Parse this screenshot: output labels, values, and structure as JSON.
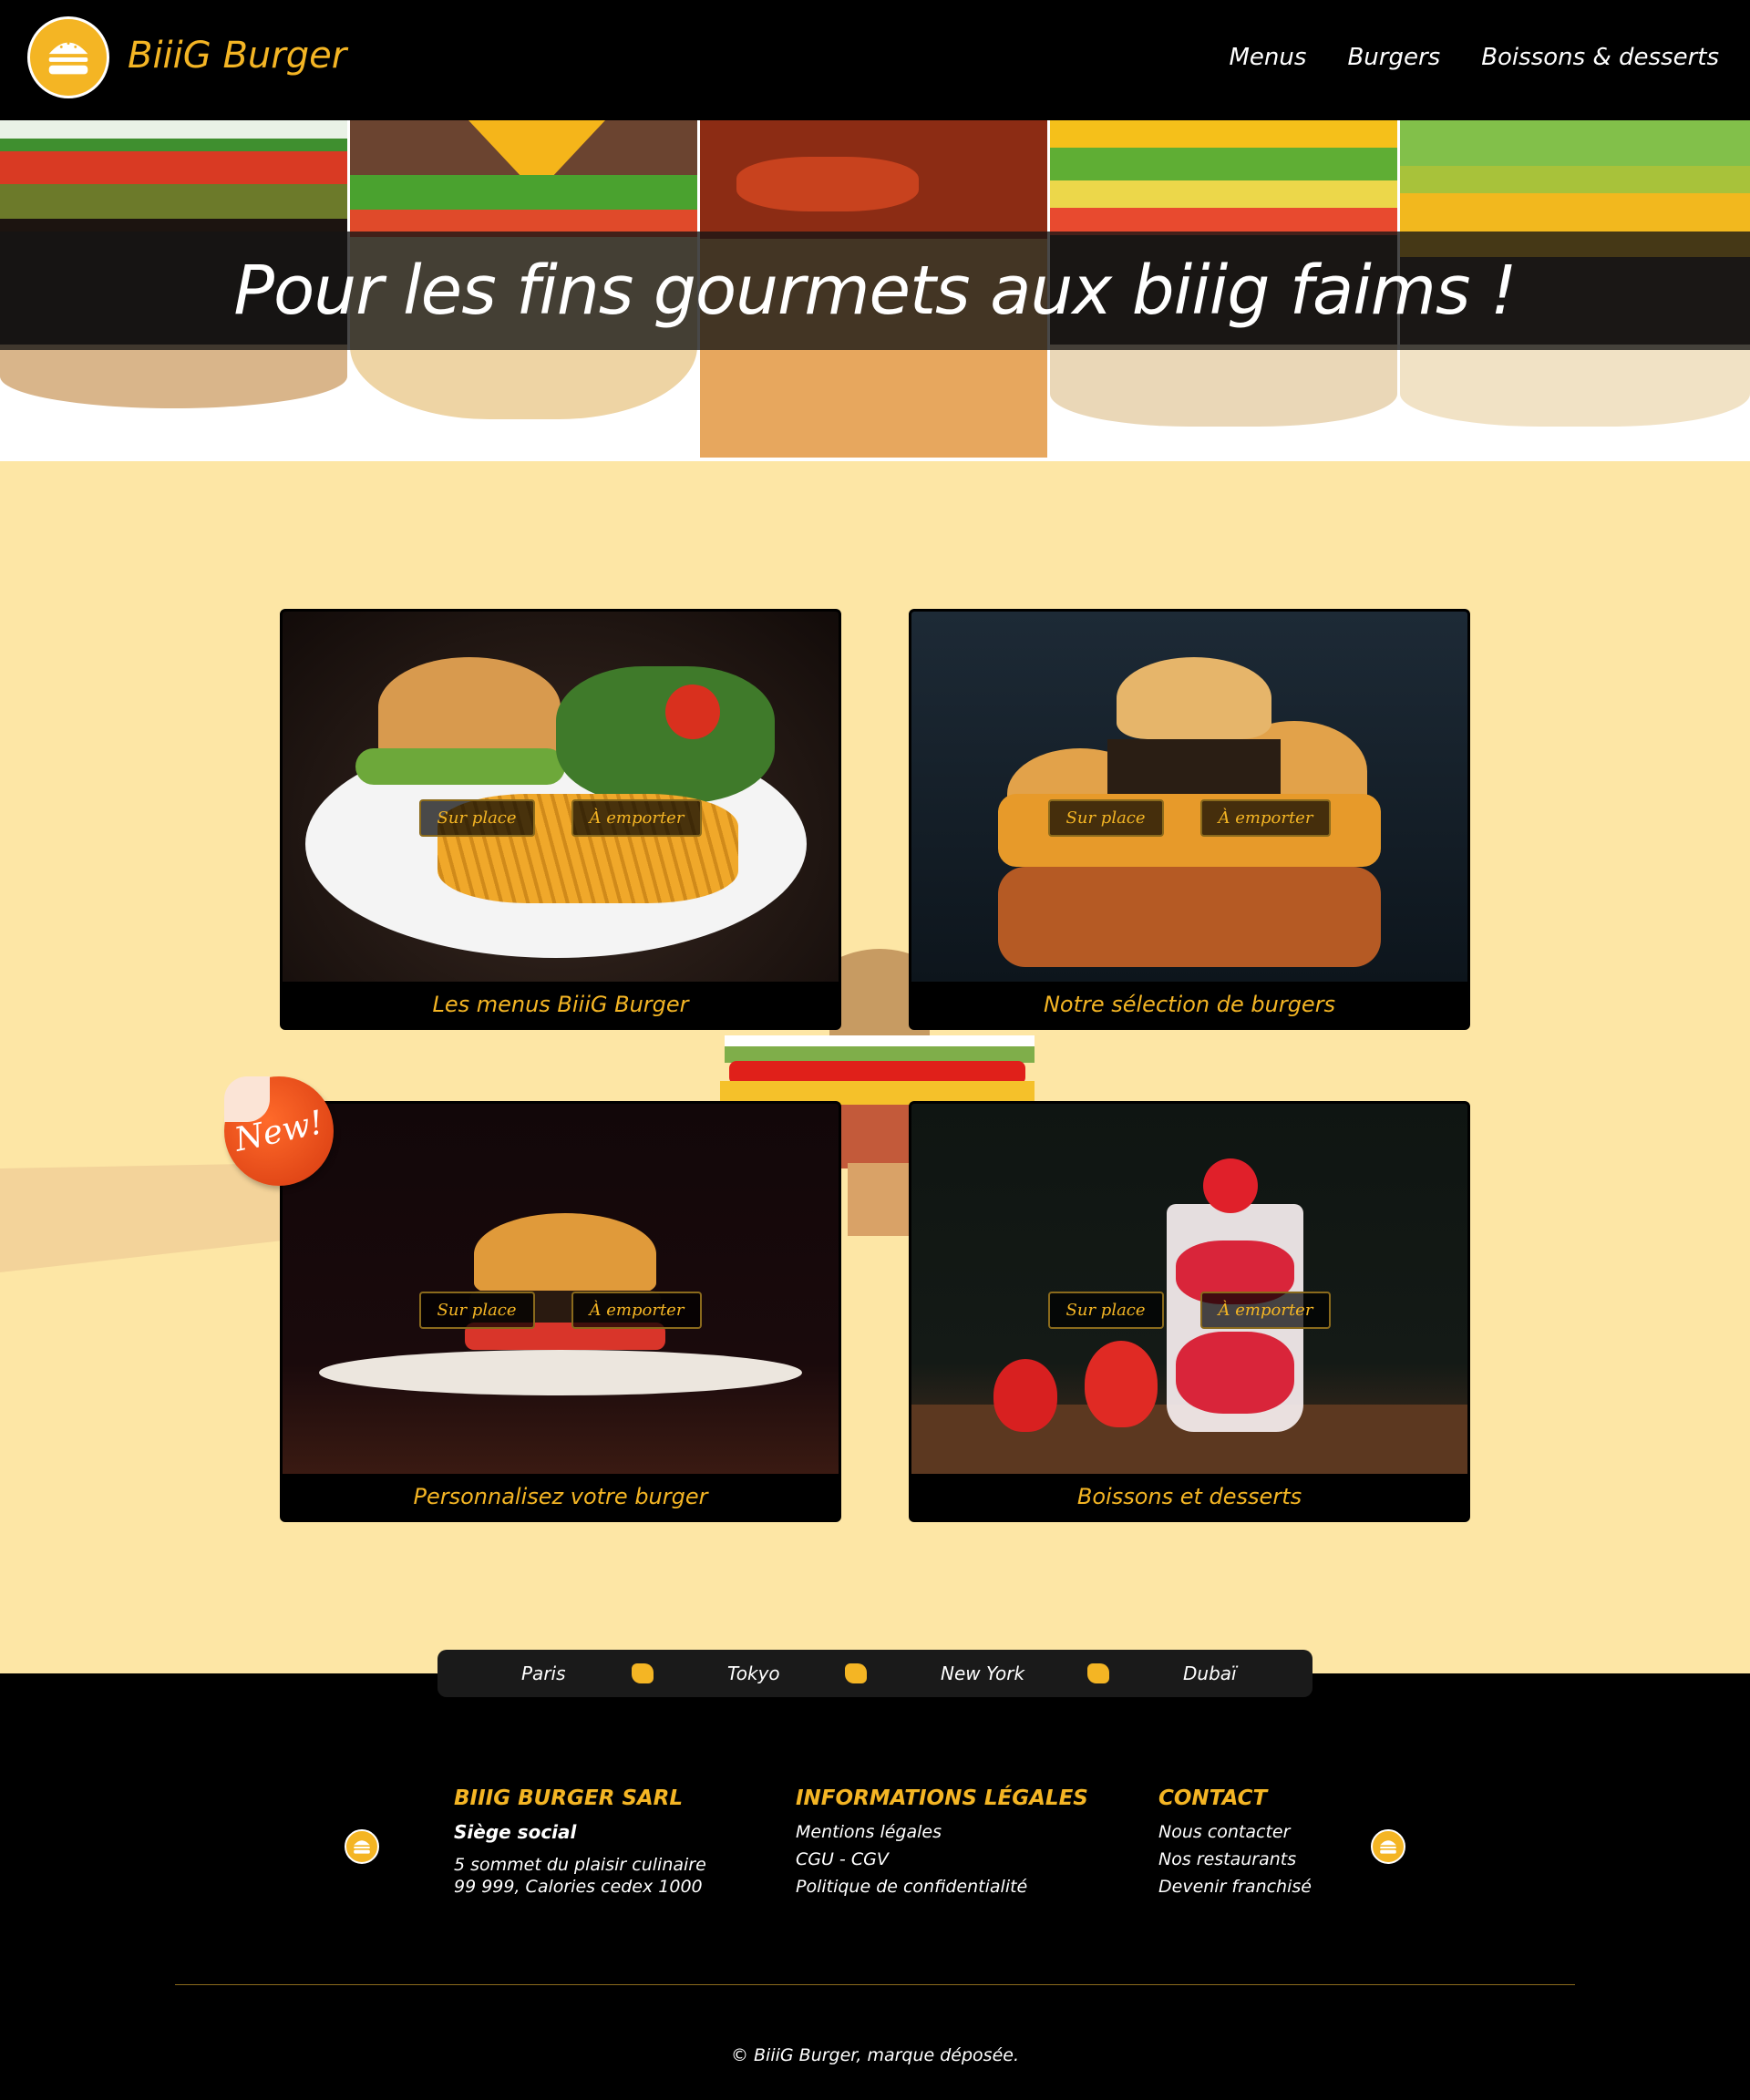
{
  "header": {
    "brand": "BiiiG Burger",
    "nav": [
      "Menus",
      "Burgers",
      "Boissons & desserts"
    ]
  },
  "hero": {
    "tagline": "Pour les fins gourmets aux biiig faims !"
  },
  "cards": [
    {
      "caption": "Les menus BiiiG Burger",
      "btn_place": "Sur place",
      "btn_emporter": "À emporter"
    },
    {
      "caption": "Notre sélection de burgers",
      "btn_place": "Sur place",
      "btn_emporter": "À emporter"
    },
    {
      "caption": "Personnalisez votre burger",
      "btn_place": "Sur place",
      "btn_emporter": "À emporter"
    },
    {
      "caption": "Boissons et desserts",
      "btn_place": "Sur place",
      "btn_emporter": "À emporter"
    }
  ],
  "badge": "New!",
  "cities": [
    "Paris",
    "Tokyo",
    "New York",
    "Dubaï"
  ],
  "footer": {
    "company": {
      "title": "BIIIG BURGER SARL",
      "sub": "Siège social",
      "line1": "5 sommet du plaisir culinaire",
      "line2": "99 999, Calories cedex 1000"
    },
    "legal": {
      "title": "INFORMATIONS LÉGALES",
      "links": [
        "Mentions légales",
        "CGU - CGV",
        "Politique de confidentialité"
      ]
    },
    "contact": {
      "title": "CONTACT",
      "links": [
        "Nous contacter",
        "Nos restaurants",
        "Devenir franchisé"
      ]
    },
    "copyright": "© BiiiG Burger, marque déposée."
  },
  "colors": {
    "accent": "#f4b524",
    "background": "#fde6a5",
    "dark": "#000000"
  }
}
